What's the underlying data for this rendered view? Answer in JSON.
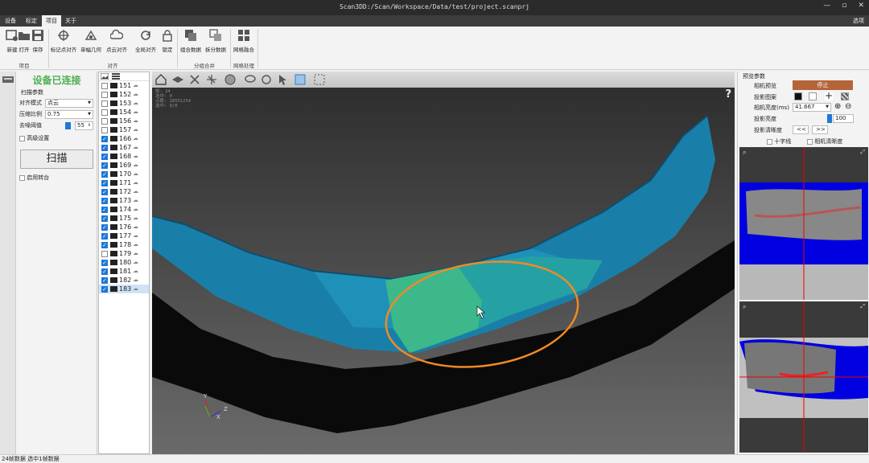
{
  "window": {
    "title": "Scan3DD:/Scan/Workspace/Data/test/project.scanprj",
    "options_label": "选项"
  },
  "menu": {
    "items": [
      "设备",
      "标定",
      "项目",
      "关于"
    ],
    "active_index": 2
  },
  "ribbon": {
    "buttons": [
      {
        "label": "新建",
        "icon": "new-project-icon"
      },
      {
        "label": "打开",
        "icon": "folder-open-icon"
      },
      {
        "label": "保存",
        "icon": "save-icon"
      },
      {
        "label": "标记点对齐",
        "icon": "marker-align-icon"
      },
      {
        "label": "单幅几何",
        "icon": "geometry-align-icon"
      },
      {
        "label": "点云对齐",
        "icon": "cloud-align-icon"
      },
      {
        "label": "全局对齐",
        "icon": "global-align-icon"
      },
      {
        "label": "锁定",
        "icon": "lock-icon"
      },
      {
        "label": "组合数据",
        "icon": "merge-data-icon"
      },
      {
        "label": "拆分数据",
        "icon": "split-data-icon"
      },
      {
        "label": "网格融合",
        "icon": "mesh-fusion-icon"
      }
    ],
    "groups": [
      "项目",
      "对齐",
      "分组合并",
      "网格处理"
    ]
  },
  "left_panel": {
    "connection_status": "设备已连接",
    "section_title": "扫描参数",
    "align_mode_label": "对齐模式",
    "align_mode_value": "点云",
    "compression_label": "压缩比例",
    "compression_value": "0.75",
    "denoise_label": "去噪阈值",
    "denoise_value": "55",
    "advanced_label": "高级设置",
    "scan_button": "扫描",
    "turntable_label": "启用转台"
  },
  "scan_list": {
    "items": [
      {
        "id": "151",
        "checked": false
      },
      {
        "id": "152",
        "checked": false
      },
      {
        "id": "153",
        "checked": false
      },
      {
        "id": "154",
        "checked": false
      },
      {
        "id": "156",
        "checked": false
      },
      {
        "id": "157",
        "checked": false
      },
      {
        "id": "166",
        "checked": true
      },
      {
        "id": "167",
        "checked": true
      },
      {
        "id": "168",
        "checked": true
      },
      {
        "id": "169",
        "checked": true
      },
      {
        "id": "170",
        "checked": true
      },
      {
        "id": "171",
        "checked": true
      },
      {
        "id": "172",
        "checked": true
      },
      {
        "id": "173",
        "checked": true
      },
      {
        "id": "174",
        "checked": true
      },
      {
        "id": "175",
        "checked": true
      },
      {
        "id": "176",
        "checked": true
      },
      {
        "id": "177",
        "checked": true
      },
      {
        "id": "178",
        "checked": true
      },
      {
        "id": "179",
        "checked": false
      },
      {
        "id": "180",
        "checked": true
      },
      {
        "id": "181",
        "checked": true
      },
      {
        "id": "182",
        "checked": true
      },
      {
        "id": "183",
        "checked": true
      }
    ],
    "selected_id": "183"
  },
  "viewport": {
    "info_lines": [
      "帧: 24",
      "选中: 0",
      "点数: 28551254",
      "选中: 0/0"
    ],
    "help": "?"
  },
  "right_panel": {
    "title": "预览参数",
    "camera_preview_label": "相机预览",
    "stop_button": "停止",
    "pattern_label": "投影图案",
    "brightness_ms_label": "相机亮度(ms)",
    "brightness_ms_value": "41.667",
    "projection_brightness_label": "投影亮度",
    "projection_brightness_value": "100",
    "clarity_label": "投影清晰度",
    "prev_btn": "<<",
    "next_btn": ">>",
    "crosshair_label": "十字线",
    "camera_clarity_label": "相机清晰度"
  },
  "status": {
    "text": "24帧数据 选中1帧数据"
  },
  "colors": {
    "accent_green": "#4caf50",
    "stop_btn": "#b5643a",
    "highlight_orange": "#f08a24",
    "mesh_teal": "#1a7fa8"
  }
}
